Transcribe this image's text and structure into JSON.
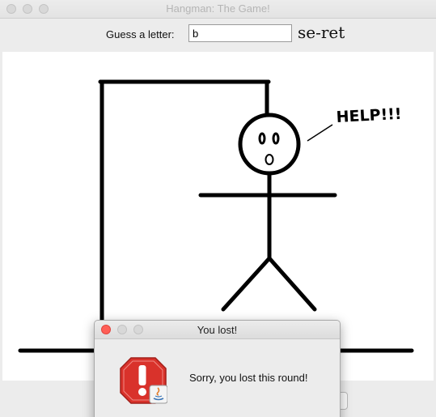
{
  "window": {
    "title": "Hangman: The Game!"
  },
  "toolbar": {
    "guess_label": "Guess a letter:",
    "guess_value": "b",
    "word_display": "se-ret"
  },
  "drawing": {
    "speech_text": "HELP!!!"
  },
  "dialog": {
    "title": "You lost!",
    "message": "Sorry, you lost this round!",
    "icon": "stop-warning-icon"
  },
  "colors": {
    "close": "#ff5f57",
    "minimize": "#ffbd2e",
    "inactive_traffic": "#d8d8d8",
    "stroke": "#000000",
    "warning_red": "#d9322b"
  }
}
